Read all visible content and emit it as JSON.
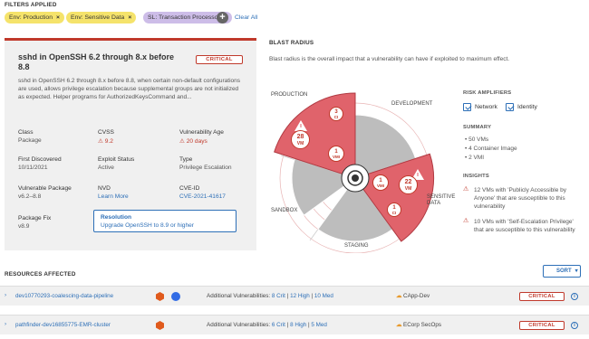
{
  "filters": {
    "title": "FILTERS APPLIED",
    "chips": [
      {
        "label": "Env: Production",
        "color": "#f5e36b"
      },
      {
        "label": "Env: Sensitive Data",
        "color": "#f5e36b"
      },
      {
        "label": "SL: Transaction Processor",
        "color": "#cdbde8"
      }
    ],
    "clear_label": "Clear All",
    "add_icon": "plus-icon"
  },
  "vuln": {
    "title": "sshd in OpenSSH 6.2 through 8.x before 8.8",
    "severity": "CRITICAL",
    "description": "sshd in OpenSSH 6.2 through 8.x before 8.8, when certain non-default configurations are used, allows privilege escalation because supplemental groups are not initialized as expected. Helper programs for AuthorizedKeysCommand and...",
    "class_label": "Class",
    "class_value": "Package",
    "cvss_label": "CVSS",
    "cvss_value": "9.2",
    "age_label": "Vulnerability Age",
    "age_value": "20 days",
    "first_label": "First Discovered",
    "first_value": "10/11/2021",
    "exploit_label": "Exploit Status",
    "exploit_value": "Active",
    "type_label": "Type",
    "type_value": "Privilege Escalation",
    "pkg_label": "Vulnerable Package",
    "pkg_value": "v6.2–8.8",
    "nvd_label": "NVD",
    "nvd_value": "Learn More",
    "cve_label": "CVE-ID",
    "cve_value": "CVE-2021-41617",
    "fix_label": "Package Fix",
    "fix_value": "v8.9",
    "resolution_label": "Resolution",
    "resolution_value": "Upgrade OpenSSH to 8.9 or higher"
  },
  "blast": {
    "title": "BLAST RADIUS",
    "subtitle": "Blast radius is the overall impact that a vulnerability can have if exploited to maximum effect.",
    "sectors": {
      "production": "PRODUCTION",
      "development": "DEVELOPMENT",
      "sensitive": "SENSITIVE DATA",
      "staging": "STAGING",
      "sandbox": "SANDBOX"
    },
    "bubbles": [
      {
        "value": "3",
        "unit": "CI"
      },
      {
        "value": "28",
        "unit": "VM"
      },
      {
        "value": "1",
        "unit": "VMI"
      },
      {
        "value": "1",
        "unit": "VMI"
      },
      {
        "value": "22",
        "unit": "VM"
      },
      {
        "value": "1",
        "unit": "CI"
      }
    ]
  },
  "amplifiers": {
    "title": "RISK AMPLIFIERS",
    "network": "Network",
    "identity": "Identity",
    "summary_title": "SUMMARY",
    "summary": [
      "50 VMs",
      "4 Container Image",
      "2 VMI"
    ],
    "insights_title": "INSIGHTS",
    "insights": [
      "12 VMs with 'Publicly Accessible by Anyone' that are susceptible to this vulnerability",
      "10 VMs with 'Self-Escalation Privilege' that are susceptible to this vulnerability"
    ]
  },
  "resources": {
    "title": "RESOURCES AFFECTED",
    "sort_label": "SORT",
    "rows": [
      {
        "name": "dev10770293-coalescing-data-pipeline",
        "vulns_label": "Additional Vulnerabilities:",
        "crit": "8 Crit",
        "high": "12 High",
        "med": "10 Med",
        "account": "CApp-Dev",
        "severity": "CRITICAL"
      },
      {
        "name": "pathfinder-dev16855775-EMR-cluster",
        "vulns_label": "Additional Vulnerabilities:",
        "crit": "6 Crit",
        "high": "8 High",
        "med": "5 Med",
        "account": "ECorp SecOps",
        "severity": "CRITICAL"
      }
    ]
  },
  "colors": {
    "critical": "#c0392b",
    "accent": "#2d6fb7",
    "sector_fill": "#e0636b",
    "gray_fill": "#bdbdbd"
  }
}
